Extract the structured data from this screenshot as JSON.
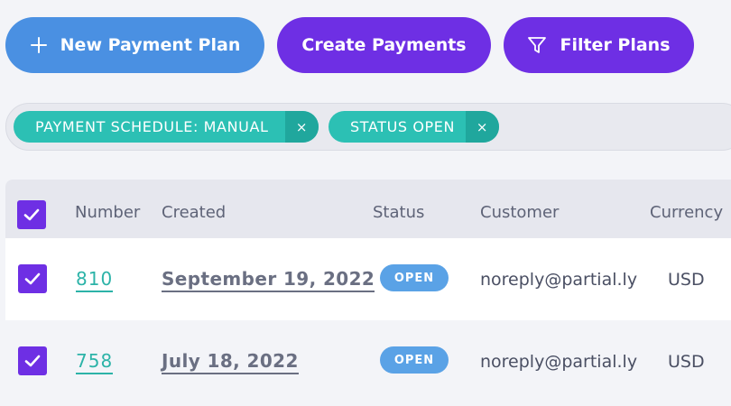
{
  "toolbar": {
    "new_plan_label": "New Payment Plan",
    "create_payments_label": "Create Payments",
    "filter_plans_label": "Filter Plans",
    "new_plan_icon": "plus-icon",
    "filter_icon": "funnel-icon"
  },
  "filters": [
    {
      "label": "PAYMENT SCHEDULE: MANUAL",
      "remove": "×"
    },
    {
      "label": "STATUS OPEN",
      "remove": "×"
    }
  ],
  "table": {
    "columns": [
      "Number",
      "Created",
      "Status",
      "Customer",
      "Currency"
    ],
    "rows": [
      {
        "number": "810",
        "created": "September 19, 2022",
        "status": "OPEN",
        "customer": "noreply@partial.ly",
        "currency": "USD",
        "selected": true
      },
      {
        "number": "758",
        "created": "July 18, 2022",
        "status": "OPEN",
        "customer": "noreply@partial.ly",
        "currency": "USD",
        "selected": true
      }
    ],
    "select_all": true
  },
  "colors": {
    "primary_blue": "#4a90e2",
    "purple": "#6e2fe4",
    "teal": "#2cc0b4",
    "status_open": "#5aa2e6"
  }
}
